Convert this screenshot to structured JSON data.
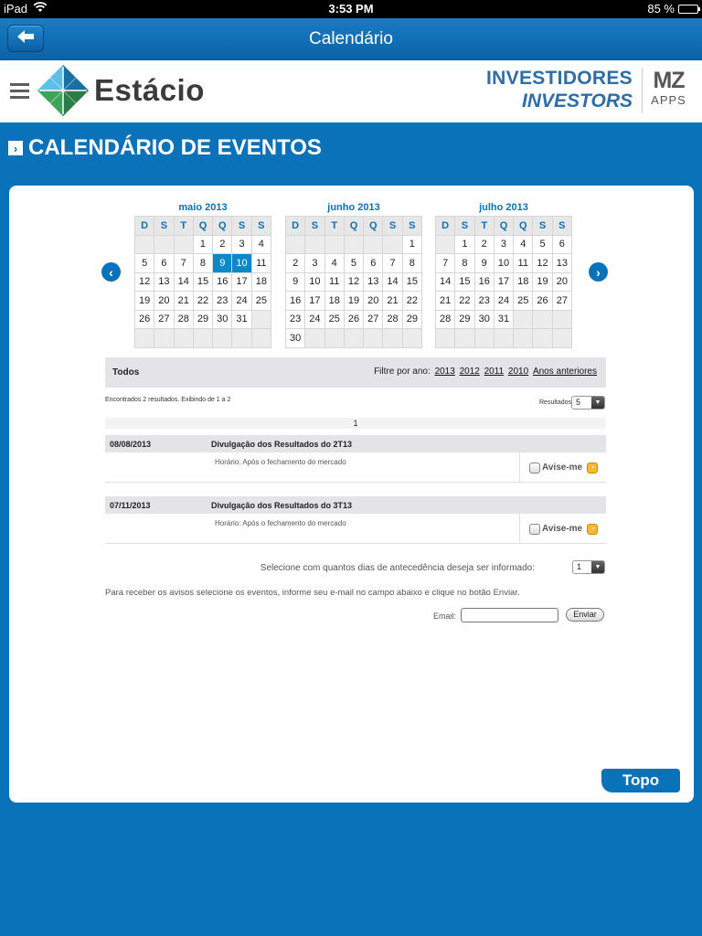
{
  "status_bar": {
    "device": "iPad",
    "time": "3:53 PM",
    "battery": "85 %",
    "battery_level": 0.85
  },
  "nav": {
    "title": "Calendário",
    "back_icon": "back-arrow-icon"
  },
  "header": {
    "brand": "Estácio",
    "investors_pt": "INVESTIDORES",
    "investors_en": "INVESTORS",
    "mz_logo": "MZ",
    "mz_sub": "APPS"
  },
  "page": {
    "heading": "CALENDÁRIO DE EVENTOS"
  },
  "calendars": [
    {
      "month": "maio 2013",
      "weekdays": [
        "D",
        "S",
        "T",
        "Q",
        "Q",
        "S",
        "S"
      ],
      "weeks": [
        [
          "",
          "",
          "",
          "1",
          "2",
          "3",
          "4"
        ],
        [
          "5",
          "6",
          "7",
          "8",
          "9",
          "10",
          "11"
        ],
        [
          "12",
          "13",
          "14",
          "15",
          "16",
          "17",
          "18"
        ],
        [
          "19",
          "20",
          "21",
          "22",
          "23",
          "24",
          "25"
        ],
        [
          "26",
          "27",
          "28",
          "29",
          "30",
          "31",
          ""
        ],
        [
          "",
          "",
          "",
          "",
          "",
          "",
          ""
        ]
      ],
      "highlighted": [
        "9",
        "10"
      ]
    },
    {
      "month": "junho 2013",
      "weekdays": [
        "D",
        "S",
        "T",
        "Q",
        "Q",
        "S",
        "S"
      ],
      "weeks": [
        [
          "",
          "",
          "",
          "",
          "",
          "",
          "1"
        ],
        [
          "2",
          "3",
          "4",
          "5",
          "6",
          "7",
          "8"
        ],
        [
          "9",
          "10",
          "11",
          "12",
          "13",
          "14",
          "15"
        ],
        [
          "16",
          "17",
          "18",
          "19",
          "20",
          "21",
          "22"
        ],
        [
          "23",
          "24",
          "25",
          "26",
          "27",
          "28",
          "29"
        ],
        [
          "30",
          "",
          "",
          "",
          "",
          "",
          ""
        ]
      ],
      "highlighted": []
    },
    {
      "month": "julho 2013",
      "weekdays": [
        "D",
        "S",
        "T",
        "Q",
        "Q",
        "S",
        "S"
      ],
      "weeks": [
        [
          "",
          "1",
          "2",
          "3",
          "4",
          "5",
          "6"
        ],
        [
          "7",
          "8",
          "9",
          "10",
          "11",
          "12",
          "13"
        ],
        [
          "14",
          "15",
          "16",
          "17",
          "18",
          "19",
          "20"
        ],
        [
          "21",
          "22",
          "23",
          "24",
          "25",
          "26",
          "27"
        ],
        [
          "28",
          "29",
          "30",
          "31",
          "",
          "",
          ""
        ],
        [
          "",
          "",
          "",
          "",
          "",
          "",
          ""
        ]
      ],
      "highlighted": []
    }
  ],
  "filter": {
    "all_label": "Todos",
    "by_year_label": "Filtre por ano:",
    "years": [
      "2013",
      "2012",
      "2011",
      "2010",
      "Anos anteriores"
    ]
  },
  "results": {
    "found_text": "Encontrados 2 resultados. Exibindo de 1 a 2",
    "per_page_label": "Resultados por página:",
    "per_page_value": "5",
    "page": "1"
  },
  "events": [
    {
      "date": "08/08/2013",
      "title": "Divulgação dos Resultados do 2T13",
      "time": "Horário: Após o fechamento do mercado",
      "notify_label": "Avise-me"
    },
    {
      "date": "07/11/2013",
      "title": "Divulgação dos Resultados do 3T13",
      "time": "Horário: Após o fechamento do mercado",
      "notify_label": "Avise-me"
    }
  ],
  "notify": {
    "advance_label": "Selecione com quantos dias de antecedência deseja ser informado:",
    "advance_value": "1",
    "instructions": "Para receber os avisos selecione os eventos, informe seu e-mail no campo abaixo e clique no botão Enviar.",
    "email_label": "Email:",
    "email_value": "",
    "send_label": "Enviar"
  },
  "footer": {
    "top_label": "Topo"
  },
  "colors": {
    "brand_blue": "#0a72b9",
    "highlight": "#0a88c9",
    "header_bg": "#e4e4e8"
  }
}
